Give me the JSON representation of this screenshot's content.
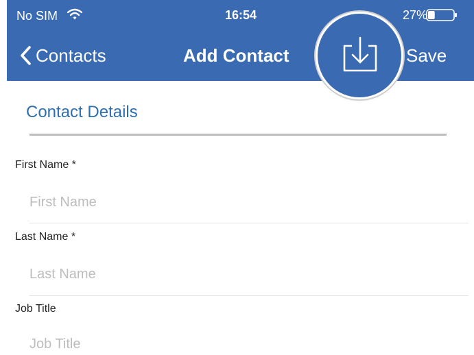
{
  "status_bar": {
    "carrier": "No SIM",
    "time": "16:54",
    "battery_percent": "27%",
    "battery_level": 0.27
  },
  "nav": {
    "back_label": "Contacts",
    "title": "Add Contact",
    "save_label": "Save"
  },
  "section": {
    "title": "Contact Details"
  },
  "fields": [
    {
      "label": "First Name *",
      "placeholder": "First Name"
    },
    {
      "label": "Last Name *",
      "placeholder": "Last Name"
    },
    {
      "label": "Job Title",
      "placeholder": "Job Title"
    }
  ],
  "colors": {
    "header_bg": "#3a6bb2",
    "accent": "#2f6fad",
    "placeholder": "#bdbdbd"
  },
  "icons": [
    "wifi-icon",
    "battery-icon",
    "chevron-left-icon",
    "download-icon"
  ]
}
